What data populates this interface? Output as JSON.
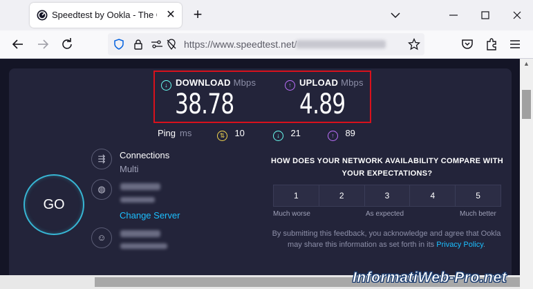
{
  "browser": {
    "tab_title": "Speedtest by Ookla - The Global Broadband Speed Test",
    "url_host": "https://www.speedtest.net/"
  },
  "results": {
    "download_label": "DOWNLOAD",
    "download_unit": "Mbps",
    "download_value": "38.78",
    "upload_label": "UPLOAD",
    "upload_unit": "Mbps",
    "upload_value": "4.89"
  },
  "ping": {
    "label": "Ping",
    "unit": "ms",
    "idle": "10",
    "download": "21",
    "upload": "89"
  },
  "go_label": "GO",
  "connections": {
    "title": "Connections",
    "value": "Multi"
  },
  "server": {
    "change_label": "Change Server"
  },
  "survey": {
    "question": "HOW DOES YOUR NETWORK AVAILABILITY COMPARE WITH YOUR EXPECTATIONS?",
    "options": [
      "1",
      "2",
      "3",
      "4",
      "5"
    ],
    "low_label": "Much worse",
    "mid_label": "As expected",
    "high_label": "Much better",
    "disclaimer": "By submitting this feedback, you acknowledge and agree that Ookla may share this information as set forth in its",
    "policy_link": "Privacy Policy",
    "period": "."
  },
  "watermark": "InformatiWeb-Pro.net",
  "colors": {
    "page_bg": "#141526",
    "card_bg": "#23243a",
    "download_accent": "#6afff3",
    "upload_accent": "#bf71ff",
    "go_ring": "#37b6d4",
    "link": "#1cbfff",
    "highlight_box": "#d8111c"
  }
}
